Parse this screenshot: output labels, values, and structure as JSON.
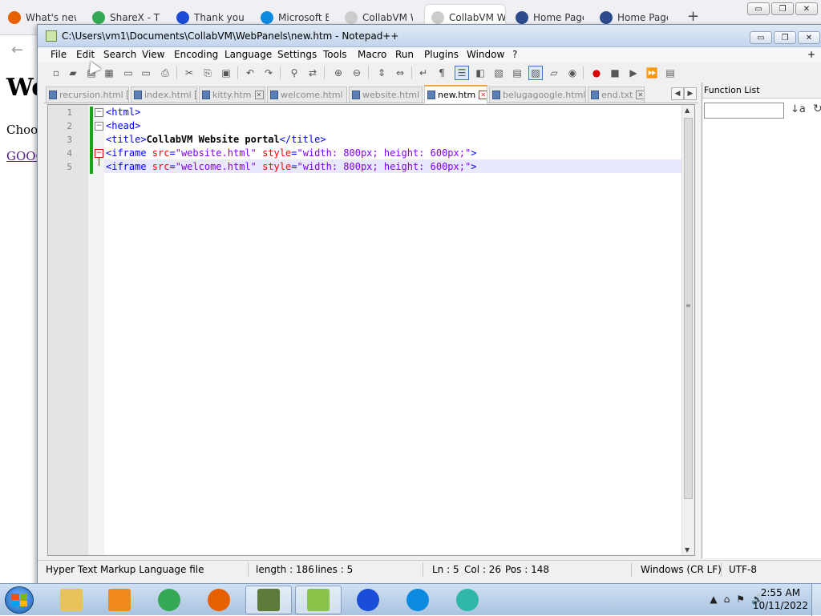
{
  "browser": {
    "tabs": [
      {
        "label": "What's new",
        "icon": "firefox-icon",
        "color": "#e66000"
      },
      {
        "label": "ShareX - Th",
        "icon": "chrome-icon",
        "color": "#34a853"
      },
      {
        "label": "Thank you",
        "icon": "malwarebytes-icon",
        "color": "#1a4dd8"
      },
      {
        "label": "Microsoft E",
        "icon": "edge-icon",
        "color": "#0c8ae0"
      },
      {
        "label": "CollabVM Web",
        "icon": "page-icon",
        "color": "#cccccc"
      },
      {
        "label": "CollabVM W",
        "icon": "page-icon",
        "color": "#cccccc",
        "active": true
      },
      {
        "label": "Home Page",
        "icon": "pbs-icon",
        "color": "#2c4a8c"
      },
      {
        "label": "Home Page",
        "icon": "pbs-icon",
        "color": "#2c4a8c"
      }
    ],
    "new_tab": "+",
    "back": "←",
    "page": {
      "heading": "We",
      "text": "Choos",
      "link": "GOOG"
    },
    "wincontrols": {
      "min": "▭",
      "max": "❐",
      "close": "✕"
    }
  },
  "npp": {
    "title": "C:\\Users\\vm1\\Documents\\CollabVM\\WebPanels\\new.htm - Notepad++",
    "menu": [
      "File",
      "Edit",
      "Search",
      "View",
      "Encoding",
      "Language",
      "Settings",
      "Tools",
      "Macro",
      "Run",
      "Plugins",
      "Window",
      "?"
    ],
    "menu_plus": "+",
    "tabs": [
      {
        "label": "recursion.html",
        "active": false
      },
      {
        "label": "index.html",
        "active": false
      },
      {
        "label": "kitty.htm",
        "active": false
      },
      {
        "label": "welcome.html",
        "active": false
      },
      {
        "label": "website.html",
        "active": false
      },
      {
        "label": "new.htm",
        "active": true
      },
      {
        "label": "belugagoogle.html",
        "active": false
      },
      {
        "label": "end.txt",
        "active": false
      }
    ],
    "line_numbers": [
      "1",
      "2",
      "3",
      "4",
      "5"
    ],
    "code_lines": [
      [
        {
          "t": "tag",
          "v": "<html>"
        }
      ],
      [
        {
          "t": "tag",
          "v": "<head>"
        }
      ],
      [
        {
          "t": "tag",
          "v": "<title>"
        },
        {
          "t": "txt",
          "v": "CollabVM Website portal"
        },
        {
          "t": "tag",
          "v": "</title>"
        }
      ],
      [
        {
          "t": "tag",
          "v": "<iframe "
        },
        {
          "t": "attr",
          "v": "src"
        },
        {
          "t": "tag",
          "v": "="
        },
        {
          "t": "str",
          "v": "\"website.html\""
        },
        {
          "t": "tag",
          "v": " "
        },
        {
          "t": "attr",
          "v": "style"
        },
        {
          "t": "tag",
          "v": "="
        },
        {
          "t": "str",
          "v": "\"width: 800px; height: 600px;\""
        },
        {
          "t": "tag",
          "v": ">"
        }
      ],
      [
        {
          "t": "tag",
          "v": "<iframe "
        },
        {
          "t": "attr",
          "v": "src"
        },
        {
          "t": "tag",
          "v": "="
        },
        {
          "t": "str",
          "v": "\"welcome.html\""
        },
        {
          "t": "tag",
          "v": " "
        },
        {
          "t": "attr",
          "v": "style"
        },
        {
          "t": "tag",
          "v": "="
        },
        {
          "t": "str",
          "v": "\"width: 800px; height: 600px;\""
        },
        {
          "t": "tag",
          "v": ">"
        }
      ]
    ],
    "function_list": {
      "title": "Function List",
      "sort_icon": "↓a",
      "reload_icon": "↻"
    },
    "status": {
      "filetype": "Hyper Text Markup Language file",
      "length": "length : 186",
      "lines": "lines : 5",
      "ln": "Ln : 5",
      "col": "Col : 26",
      "pos": "Pos : 148",
      "eol": "Windows (CR LF)",
      "encoding": "UTF-8"
    },
    "wincontrols": {
      "min": "▭",
      "max": "❐",
      "close": "✕"
    },
    "colors": {
      "tag": "#0000ff",
      "attr": "#ff0000",
      "string": "#8000ff",
      "change_bar": "#1aa31a"
    }
  },
  "taskbar": {
    "apps": [
      {
        "name": "file-explorer-icon",
        "color": "#e8c25a",
        "open": false
      },
      {
        "name": "media-player-icon",
        "color": "#f08a1c",
        "open": false
      },
      {
        "name": "chrome-icon",
        "color": "#34a853",
        "open": false
      },
      {
        "name": "firefox-icon",
        "color": "#e66000",
        "open": false
      },
      {
        "name": "terminal-icon",
        "color": "#5d7a3a",
        "open": true
      },
      {
        "name": "notepadpp-icon",
        "color": "#8bc34a",
        "open": true
      },
      {
        "name": "malwarebytes-icon",
        "color": "#1a4dd8",
        "open": false
      },
      {
        "name": "edge-icon",
        "color": "#0c8ae0",
        "open": false
      },
      {
        "name": "edge-canary-icon",
        "color": "#2fb8a8",
        "open": false
      }
    ],
    "tray": [
      "▲",
      "⌂",
      "⚑",
      "🔊"
    ],
    "time": "2:55 AM",
    "date": "10/11/2022"
  }
}
